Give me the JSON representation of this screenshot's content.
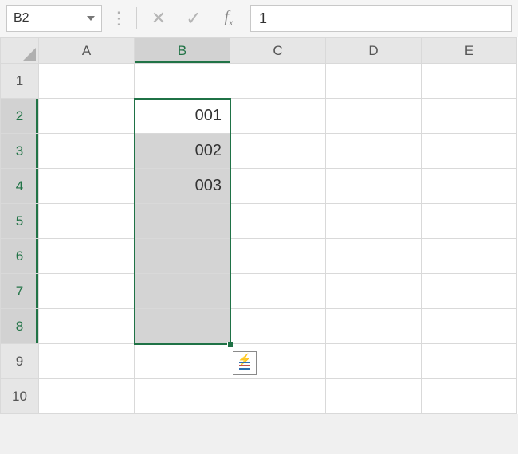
{
  "namebox": {
    "value": "B2"
  },
  "formula_bar": {
    "cancel_glyph": "✕",
    "enter_glyph": "✓",
    "fx_label": "f",
    "fx_sub": "x",
    "value": "1"
  },
  "grid": {
    "columns": [
      "A",
      "B",
      "C",
      "D",
      "E"
    ],
    "selected_column_index": 1,
    "rows": [
      "1",
      "2",
      "3",
      "4",
      "5",
      "6",
      "7",
      "8",
      "9",
      "10"
    ],
    "selected_row_start": 1,
    "selected_row_end": 7,
    "active_cell": "B2",
    "cells": {
      "B2": "001",
      "B3": "002",
      "B4": "003"
    }
  },
  "colors": {
    "excel_green": "#1f7246"
  }
}
